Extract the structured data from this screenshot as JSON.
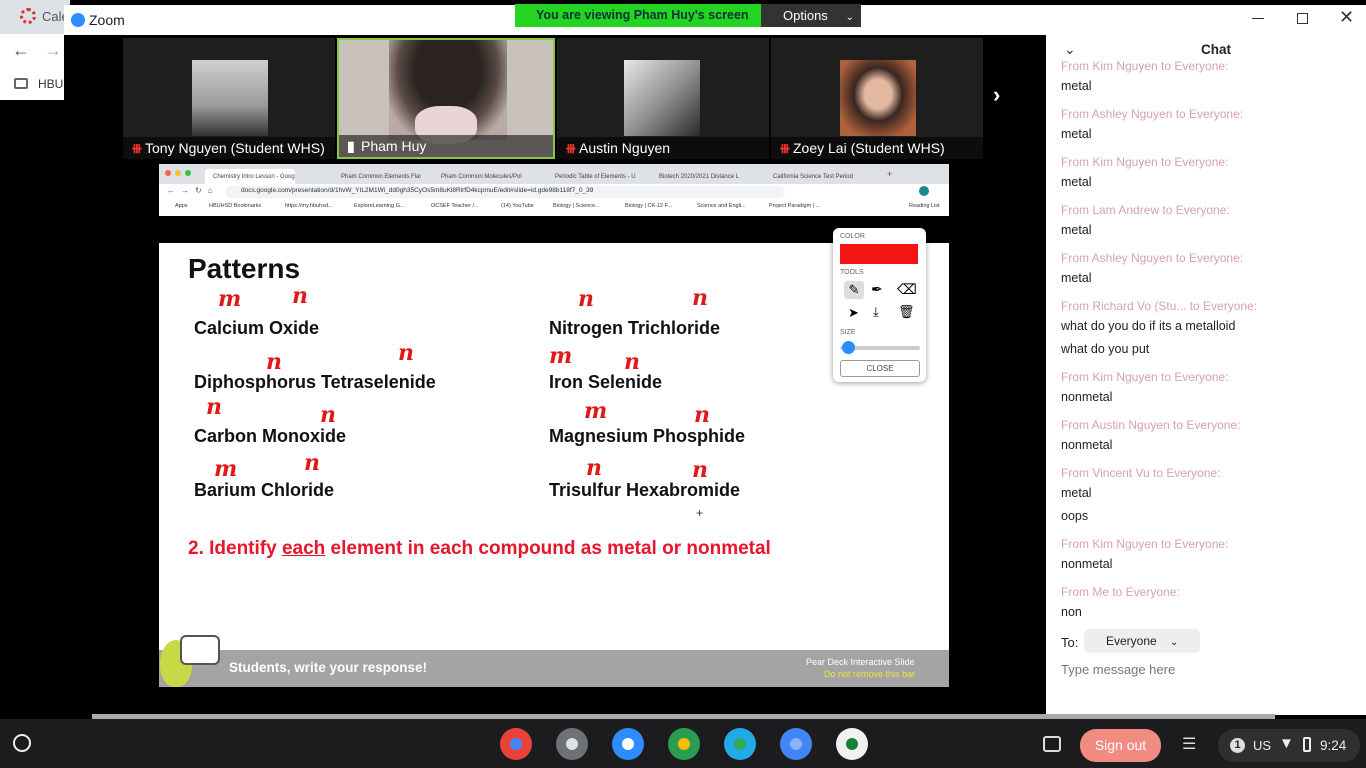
{
  "background_window": {
    "tab_text": "Cale",
    "bookmark_text": "HBU"
  },
  "zoom": {
    "window_title": "Zoom",
    "viewing_banner": "You are viewing Pham Huy's screen",
    "options_label": "Options"
  },
  "participants": [
    {
      "name": "Tony Nguyen (Student WHS)",
      "muted": true
    },
    {
      "name": "Pham Huy",
      "muted": false
    },
    {
      "name": "Austin Nguyen",
      "muted": true
    },
    {
      "name": "Zoey Lai (Student WHS)",
      "muted": true
    }
  ],
  "browser": {
    "tabs": [
      "Chemistry Intro Lesson - Goog",
      "Pham Common Elements Flash",
      "Pham Common Molecules/Pol",
      "Periodic Table of Elements - U",
      "Biotech 2020/2021 Distance L",
      "California Science Test Period"
    ],
    "url": "docs.google.com/presentation/d/1hvW_YIL2M1Wi_dd0gh35CyOs5m8uKl8RlrfD4kcpmuE/edit#slide=id.gde98b118f7_0_39",
    "bookmarks": [
      "Apps",
      "HBUHSD Bookmarks",
      "https://my.hbuhsd...",
      "ExploreLearning G...",
      "OCSEF Teacher /...",
      "(14) YouTube",
      "Biology | Science...",
      "Biology | CK-12 F...",
      "Science and Engli...",
      "Project Paradigm | ...",
      "Reading List"
    ]
  },
  "slide": {
    "title": "Patterns",
    "compounds": [
      {
        "name": "Calcium Oxide",
        "anno": [
          "m",
          "n"
        ]
      },
      {
        "name": "Nitrogen Trichloride",
        "anno": [
          "n",
          "n"
        ]
      },
      {
        "name": "Diphosphorus Tetraselenide",
        "anno": [
          "n",
          "n"
        ]
      },
      {
        "name": "Iron Selenide",
        "anno": [
          "m",
          "n"
        ]
      },
      {
        "name": "Carbon Monoxide",
        "anno": [
          "n",
          "n"
        ]
      },
      {
        "name": "Magnesium Phosphide",
        "anno": [
          "m",
          "n"
        ]
      },
      {
        "name": "Barium Chloride",
        "anno": [
          "m",
          "n"
        ]
      },
      {
        "name": "Trisulfur Hexabromide",
        "anno": [
          "n",
          "n"
        ]
      }
    ],
    "instruction": {
      "pre": "2. Identify ",
      "underlined": "each",
      "post": " element in each compound as metal or nonmetal"
    },
    "cursor": "+"
  },
  "annotate_tool": {
    "color_label": "COLOR",
    "current_color": "#f41414",
    "tools_label": "TOOLS",
    "size_label": "SIZE",
    "size_value": 0.05,
    "close_label": "CLOSE"
  },
  "pear_deck": {
    "prompt": "Students, write your response!",
    "label": "Pear Deck Interactive Slide",
    "warning": "Do not remove this bar"
  },
  "chat": {
    "title": "Chat",
    "messages": [
      {
        "from": "From Kim Nguyen to Everyone:",
        "lines": [
          "metal"
        ]
      },
      {
        "from": "From Ashley Nguyen to Everyone:",
        "lines": [
          "metal"
        ]
      },
      {
        "from": "From Kim Nguyen to Everyone:",
        "lines": [
          "metal"
        ]
      },
      {
        "from": "From Lam Andrew to Everyone:",
        "lines": [
          "metal"
        ]
      },
      {
        "from": "From Ashley Nguyen to Everyone:",
        "lines": [
          "metal"
        ]
      },
      {
        "from": "From Richard Vo (Stu... to Everyone:",
        "lines": [
          "what do you do if its a metalloid",
          "what do you put"
        ]
      },
      {
        "from": "From Kim Nguyen to Everyone:",
        "lines": [
          "nonmetal"
        ]
      },
      {
        "from": "From Austin Nguyen to Everyone:",
        "lines": [
          "nonmetal"
        ]
      },
      {
        "from": "From Vincent Vu to Everyone:",
        "lines": [
          "metal",
          "oops"
        ]
      },
      {
        "from": "From Kim Nguyen to Everyone:",
        "lines": [
          "nonmetal"
        ]
      },
      {
        "from": "From Me to Everyone:",
        "lines": [
          "non"
        ]
      }
    ],
    "to_label": "To:",
    "recipient": "Everyone",
    "input_placeholder": "Type message here"
  },
  "shelf": {
    "apps": [
      "chrome-icon",
      "settings-icon",
      "zoom-icon",
      "drive-icon",
      "play-store-icon",
      "files-icon",
      "cleaner-icon"
    ],
    "sign_out": "Sign out",
    "notification_count": "1",
    "locale": "US",
    "time": "9:24"
  }
}
